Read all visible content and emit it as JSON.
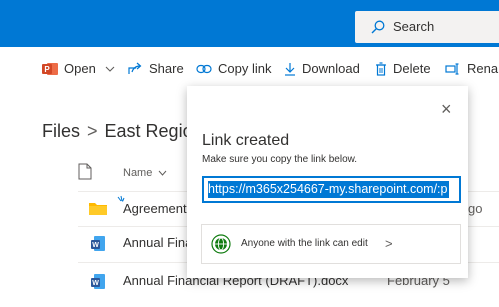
{
  "search": {
    "placeholder": "Search"
  },
  "commands": {
    "open": "Open",
    "share": "Share",
    "copy_link": "Copy link",
    "download": "Download",
    "delete": "Delete",
    "rename": "Renam"
  },
  "breadcrumb": {
    "root": "Files",
    "separator": ">",
    "current": "East Region"
  },
  "files": {
    "name_header": "Name",
    "rows": [
      {
        "name": "Agreements",
        "modified": "go"
      },
      {
        "name": "Annual Fina"
      },
      {
        "name": "Annual Financial Report (DRAFT).docx",
        "modified": "February 5"
      }
    ]
  },
  "dialog": {
    "title": "Link created",
    "subtitle": "Make sure you copy the link below.",
    "link": "https://m365x254667-my.sharepoint.com/:p",
    "permission": "Anyone with the link can edit",
    "chevron": ">",
    "close": "×"
  },
  "colors": {
    "accent": "#0078d4",
    "word": "#2b579a",
    "powerpoint": "#d24726",
    "folder": "#ffb900",
    "globe": "#107c10"
  }
}
